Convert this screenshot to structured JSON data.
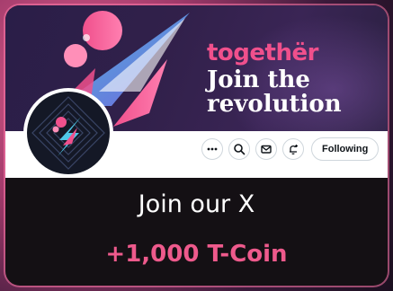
{
  "banner": {
    "brand": "togethër",
    "headline": "Join the revolution"
  },
  "profile": {
    "actions": {
      "more_icon": "more-dots-icon",
      "search_icon": "search-icon",
      "message_icon": "mail-icon",
      "notify_icon": "bell-add-icon",
      "follow_label": "Following"
    }
  },
  "task": {
    "title": "Join our X",
    "reward": "+1,000 T-Coin"
  },
  "colors": {
    "accent": "#ee5a8c",
    "card_bg": "#141014",
    "banner_bg": "#2a1e48"
  }
}
